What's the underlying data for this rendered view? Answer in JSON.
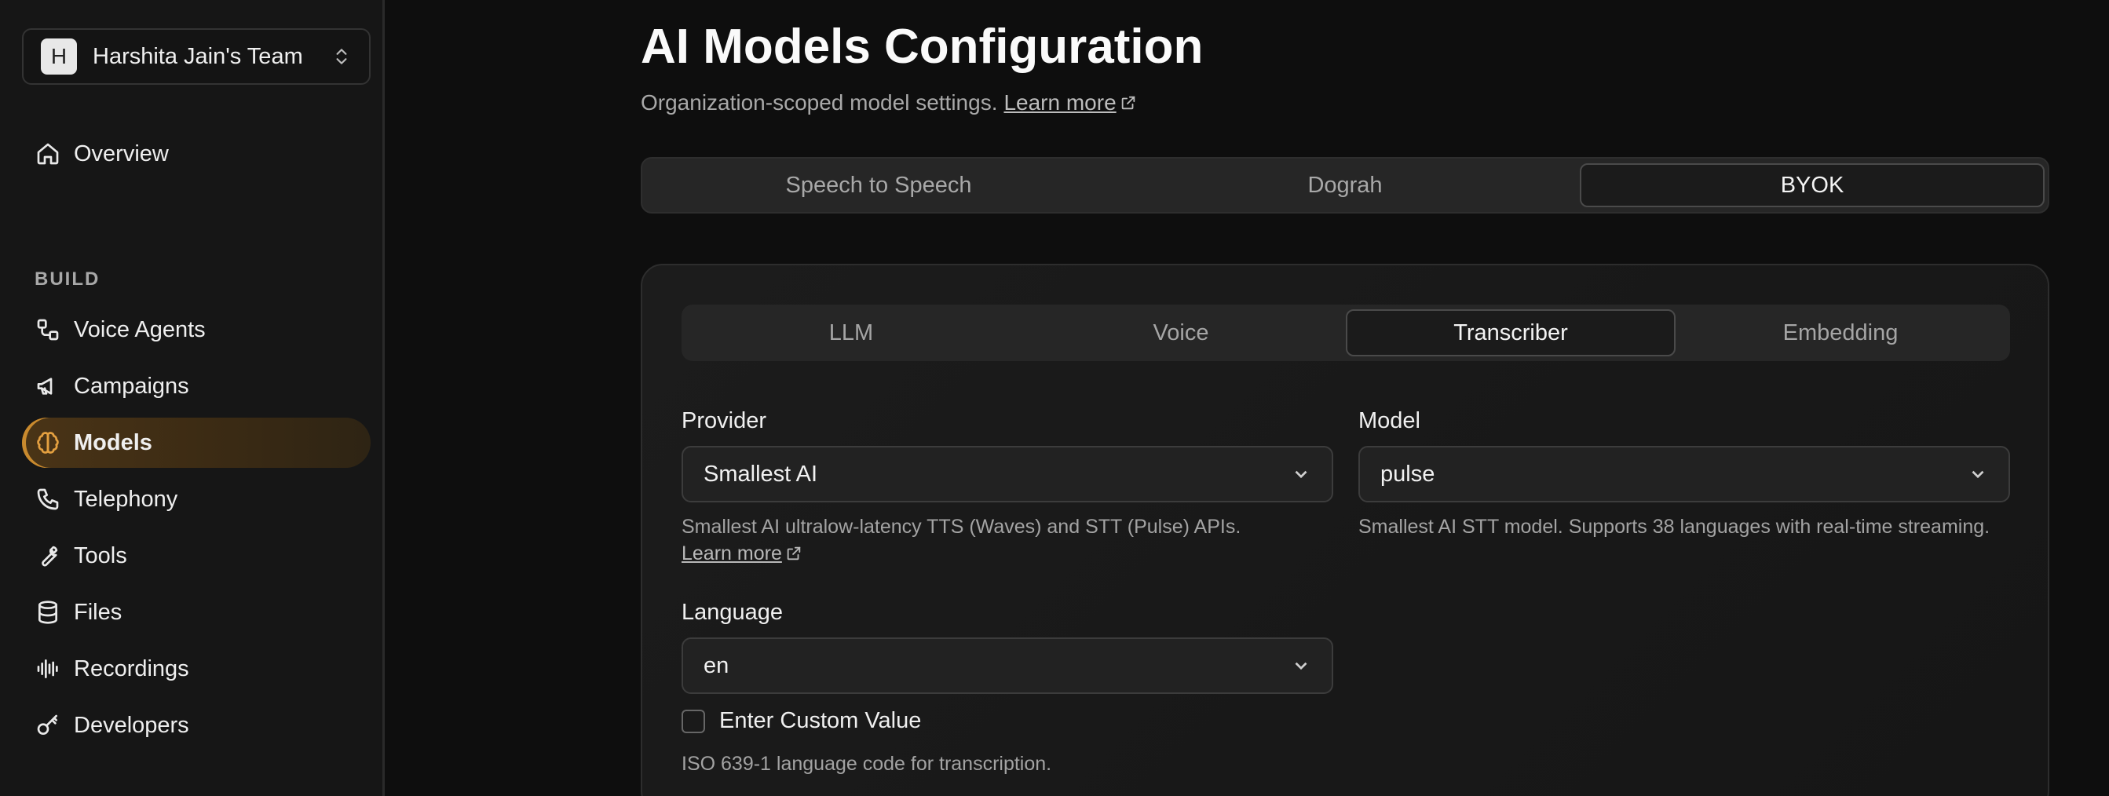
{
  "team": {
    "avatar_letter": "H",
    "name": "Harshita Jain's Team"
  },
  "nav": {
    "overview": "Overview",
    "section_build": "BUILD",
    "items": [
      {
        "label": "Voice Agents",
        "icon": "voice-agents-icon"
      },
      {
        "label": "Campaigns",
        "icon": "megaphone-icon"
      },
      {
        "label": "Models",
        "icon": "brain-icon",
        "active": true
      },
      {
        "label": "Telephony",
        "icon": "phone-icon"
      },
      {
        "label": "Tools",
        "icon": "wrench-icon"
      },
      {
        "label": "Files",
        "icon": "database-icon"
      },
      {
        "label": "Recordings",
        "icon": "waveform-icon"
      },
      {
        "label": "Developers",
        "icon": "key-icon"
      }
    ],
    "accent_color": "#c98a2e"
  },
  "page": {
    "title": "AI Models Configuration",
    "subtitle": "Organization-scoped model settings.",
    "learn_more": "Learn more"
  },
  "top_tabs": [
    "Speech to Speech",
    "Dograh",
    "BYOK"
  ],
  "top_tabs_active": "BYOK",
  "inner_tabs": [
    "LLM",
    "Voice",
    "Transcriber",
    "Embedding"
  ],
  "inner_tabs_active": "Transcriber",
  "provider": {
    "label": "Provider",
    "value": "Smallest AI",
    "help": "Smallest AI ultralow-latency TTS (Waves) and STT (Pulse) APIs.",
    "help_link": "Learn more"
  },
  "model": {
    "label": "Model",
    "value": "pulse",
    "help": "Smallest AI STT model. Supports 38 languages with real-time streaming."
  },
  "language": {
    "label": "Language",
    "value": "en",
    "custom_checkbox_label": "Enter Custom Value",
    "help": "ISO 639-1 language code for transcription."
  }
}
